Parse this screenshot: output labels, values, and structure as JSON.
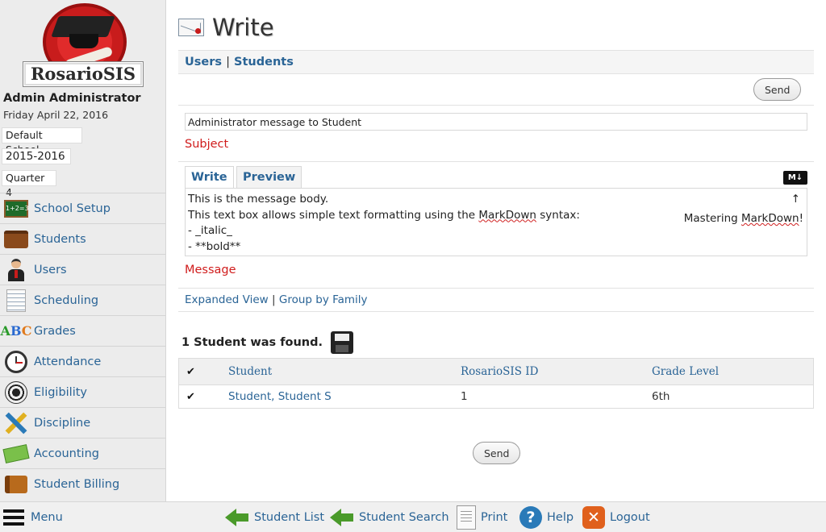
{
  "app": {
    "logo_text": "RosarioSIS"
  },
  "sidebar": {
    "user_name": "Admin Administrator",
    "date": "Friday April 22, 2016",
    "school": "Default School",
    "year": "2015-2016",
    "quarter": "Quarter 4",
    "menu": [
      {
        "label": "School Setup",
        "icon": "chalkboard-icon"
      },
      {
        "label": "Students",
        "icon": "briefcase-icon"
      },
      {
        "label": "Users",
        "icon": "user-icon"
      },
      {
        "label": "Scheduling",
        "icon": "notebook-icon"
      },
      {
        "label": "Grades",
        "icon": "abc-icon"
      },
      {
        "label": "Attendance",
        "icon": "clock-icon"
      },
      {
        "label": "Eligibility",
        "icon": "soccer-ball-icon"
      },
      {
        "label": "Discipline",
        "icon": "pencil-ruler-icon"
      },
      {
        "label": "Accounting",
        "icon": "money-icon"
      },
      {
        "label": "Student Billing",
        "icon": "wallet-icon"
      }
    ]
  },
  "header": {
    "title": "Write",
    "tab_users": "Users",
    "tab_separator": "|",
    "tab_students": "Students"
  },
  "form": {
    "send_label": "Send",
    "subject_value": "Administrator message to Student",
    "subject_label": "Subject",
    "editor_tab_write": "Write",
    "editor_tab_preview": "Preview",
    "markdown_badge": "M↓",
    "message_line1": "This is the message body.",
    "message_line2_a": "This text box allows simple text formatting using the ",
    "message_line2_b": "MarkDown",
    "message_line2_c": " syntax:",
    "message_line3": "- _italic_",
    "message_line4": "- **bold**",
    "message_hint_a": "Mastering ",
    "message_hint_b": "MarkDown",
    "message_hint_c": "!",
    "message_arrow": "↑",
    "message_label": "Message",
    "link_expanded": "Expanded View",
    "link_separator": "|",
    "link_group": "Group by Family"
  },
  "results": {
    "found_text": "1 Student was found.",
    "check_mark": "✔",
    "columns": [
      "Student",
      "RosarioSIS ID",
      "Grade Level"
    ],
    "rows": [
      {
        "student": "Student, Student S",
        "id": "1",
        "grade": "6th"
      }
    ]
  },
  "bottom_bar": {
    "menu": "Menu",
    "student_list": "Student List",
    "student_search": "Student Search",
    "print": "Print",
    "help": "Help",
    "logout": "Logout",
    "help_glyph": "?",
    "logout_glyph": "✕"
  }
}
